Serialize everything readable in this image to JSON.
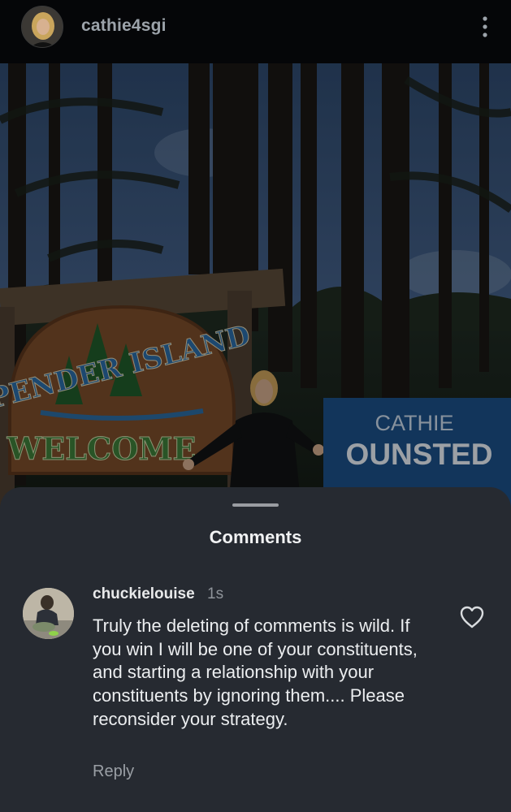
{
  "post": {
    "username": "cathie4sgi",
    "menu_icon": "more-vertical-icon",
    "photo": {
      "sign_left_line1": "PENDER ISLAND",
      "sign_left_line2": "WELCOME",
      "sign_right_line1": "CATHIE",
      "sign_right_line2": "OUNSTED"
    }
  },
  "comments_sheet": {
    "title": "Comments",
    "comments": [
      {
        "username": "chuckielouise",
        "time": "1s",
        "text": "Truly the deleting of comments is wild. If you win I will be one of your constituents, and starting a relationship with your constituents by ignoring them.... Please reconsider your strategy.",
        "reply_label": "Reply",
        "like_icon": "heart-outline-icon"
      }
    ]
  },
  "colors": {
    "background": "#07080a",
    "sheet": "#262a31",
    "text_primary": "#eceef0",
    "text_secondary": "#8f949a",
    "sign_blue": "#1b4f86",
    "sign_wood": "#8c5a33"
  }
}
